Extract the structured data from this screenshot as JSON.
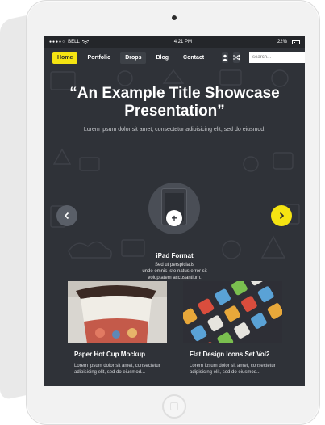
{
  "status": {
    "carrier": "BELL",
    "signal": "●●●●○",
    "time": "4:21 PM",
    "battery": "22%"
  },
  "nav": {
    "items": [
      "Home",
      "Portfolio",
      "Drops",
      "Blog",
      "Contact"
    ],
    "active_index": 0,
    "search_placeholder": "search..."
  },
  "hero": {
    "title": "“An Example Title Showcase\nPresentation”",
    "subtitle": "Lorem ipsum dolor sit amet, consectetur adipisicing elit, sed do eiusmod.",
    "feature_title": "iPad Format",
    "feature_desc": "Sed ut perspiciatis\nunde omnis iste natus error sit\nvoluptatem accusantium."
  },
  "cards": [
    {
      "title": "Paper Hot Cup Mockup",
      "desc": "Lorem ipsum dolor sit amet, consectetur adipisicing elit, sed do eiusmod..."
    },
    {
      "title": "Flat Design Icons Set Vol2",
      "desc": "Lorem ipsum dolor sit amet, consectetur adipisicing elit, sed do eiusmod..."
    }
  ],
  "colors": {
    "accent": "#f5e412",
    "screen_bg": "#2f3238",
    "statusbar_bg": "#24262a"
  },
  "icons": [
    "user-icon",
    "shuffle-icon",
    "search-icon",
    "chevron-left-icon",
    "chevron-right-icon",
    "plus-icon"
  ]
}
